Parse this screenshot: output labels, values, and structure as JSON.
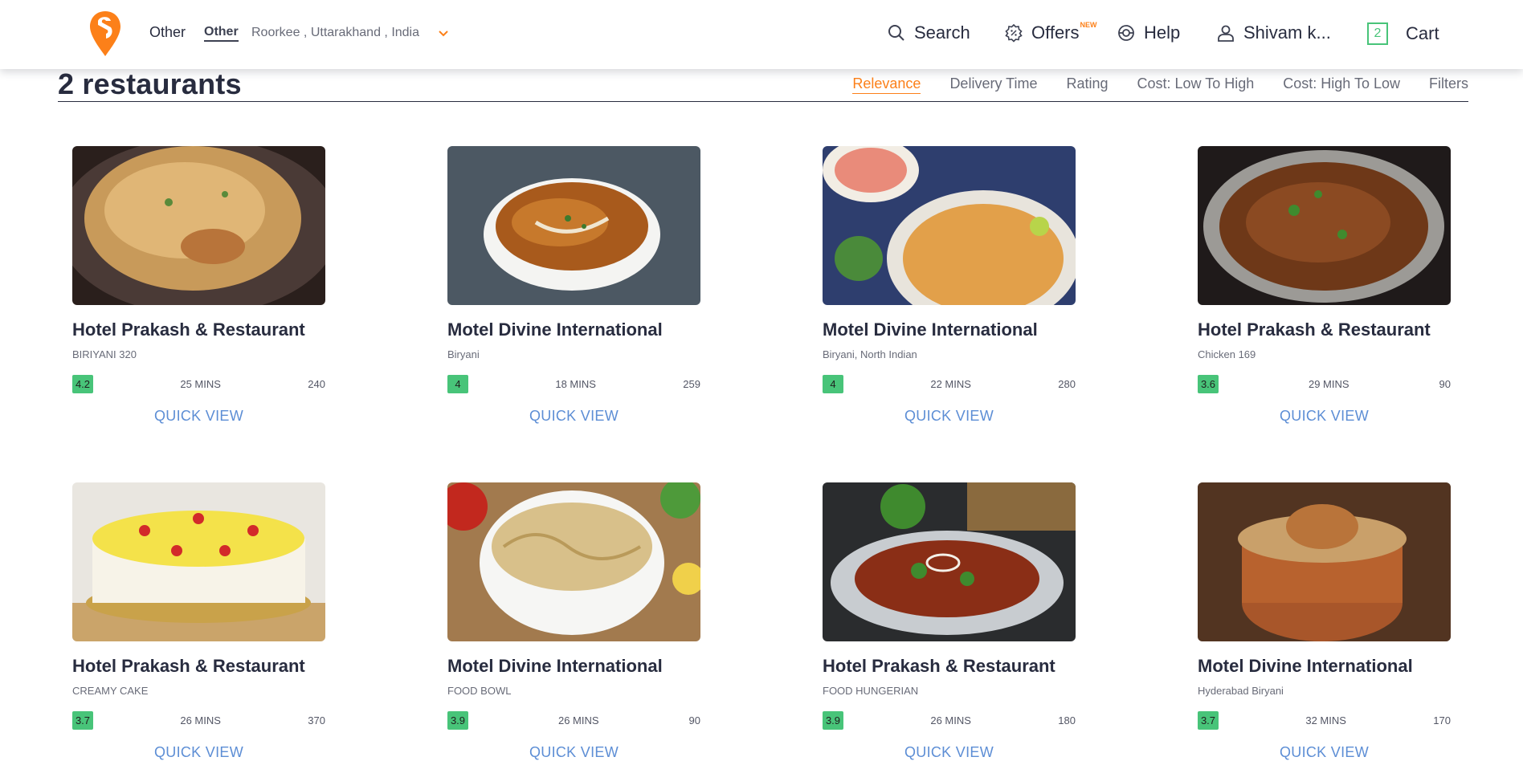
{
  "header": {
    "location_type": "Other",
    "location_label": "Other",
    "location_address": "Roorkee , Uttarakhand , India",
    "nav": {
      "search": "Search",
      "offers": "Offers",
      "offers_badge": "NEW",
      "help": "Help",
      "user": "Shivam k...",
      "cart_count": "2",
      "cart": "Cart"
    }
  },
  "listing": {
    "title": "2 restaurants",
    "sort_options": [
      "Relevance",
      "Delivery Time",
      "Rating",
      "Cost: Low To High",
      "Cost: High To Low",
      "Filters"
    ],
    "active_sort": "Relevance"
  },
  "cards": [
    {
      "name": "Hotel Prakash & Restaurant",
      "sub": "BIRIYANI 320",
      "rating": "4.2",
      "time": "25 MINS",
      "cost": "240",
      "quick": "QUICK VIEW",
      "theme": "biryani-plate"
    },
    {
      "name": "Motel Divine International",
      "sub": "Biryani",
      "rating": "4",
      "time": "18 MINS",
      "cost": "259",
      "quick": "QUICK VIEW",
      "theme": "curry-bowl"
    },
    {
      "name": "Motel Divine International",
      "sub": "Biryani, North Indian",
      "rating": "4",
      "time": "22 MINS",
      "cost": "280",
      "quick": "QUICK VIEW",
      "theme": "biryani-spread"
    },
    {
      "name": "Hotel Prakash & Restaurant",
      "sub": "Chicken 169",
      "rating": "3.6",
      "time": "29 MINS",
      "cost": "90",
      "quick": "QUICK VIEW",
      "theme": "chicken-kadhai"
    },
    {
      "name": "Hotel Prakash & Restaurant",
      "sub": "CREAMY CAKE",
      "rating": "3.7",
      "time": "26 MINS",
      "cost": "370",
      "quick": "QUICK VIEW",
      "theme": "cake"
    },
    {
      "name": "Motel Divine International",
      "sub": "FOOD BOWL",
      "rating": "3.9",
      "time": "26 MINS",
      "cost": "90",
      "quick": "QUICK VIEW",
      "theme": "noodle-bowl"
    },
    {
      "name": "Hotel Prakash & Restaurant",
      "sub": "FOOD HUNGERIAN",
      "rating": "3.9",
      "time": "26 MINS",
      "cost": "180",
      "quick": "QUICK VIEW",
      "theme": "chilli-chicken"
    },
    {
      "name": "Motel Divine International",
      "sub": "Hyderabad Biryani",
      "rating": "3.7",
      "time": "32 MINS",
      "cost": "170",
      "quick": "QUICK VIEW",
      "theme": "handi-biryani"
    }
  ],
  "colors": {
    "brand": "#fc8019",
    "rating_green": "#48c479",
    "link_blue": "#5d8ed5",
    "text": "#282c3f"
  }
}
